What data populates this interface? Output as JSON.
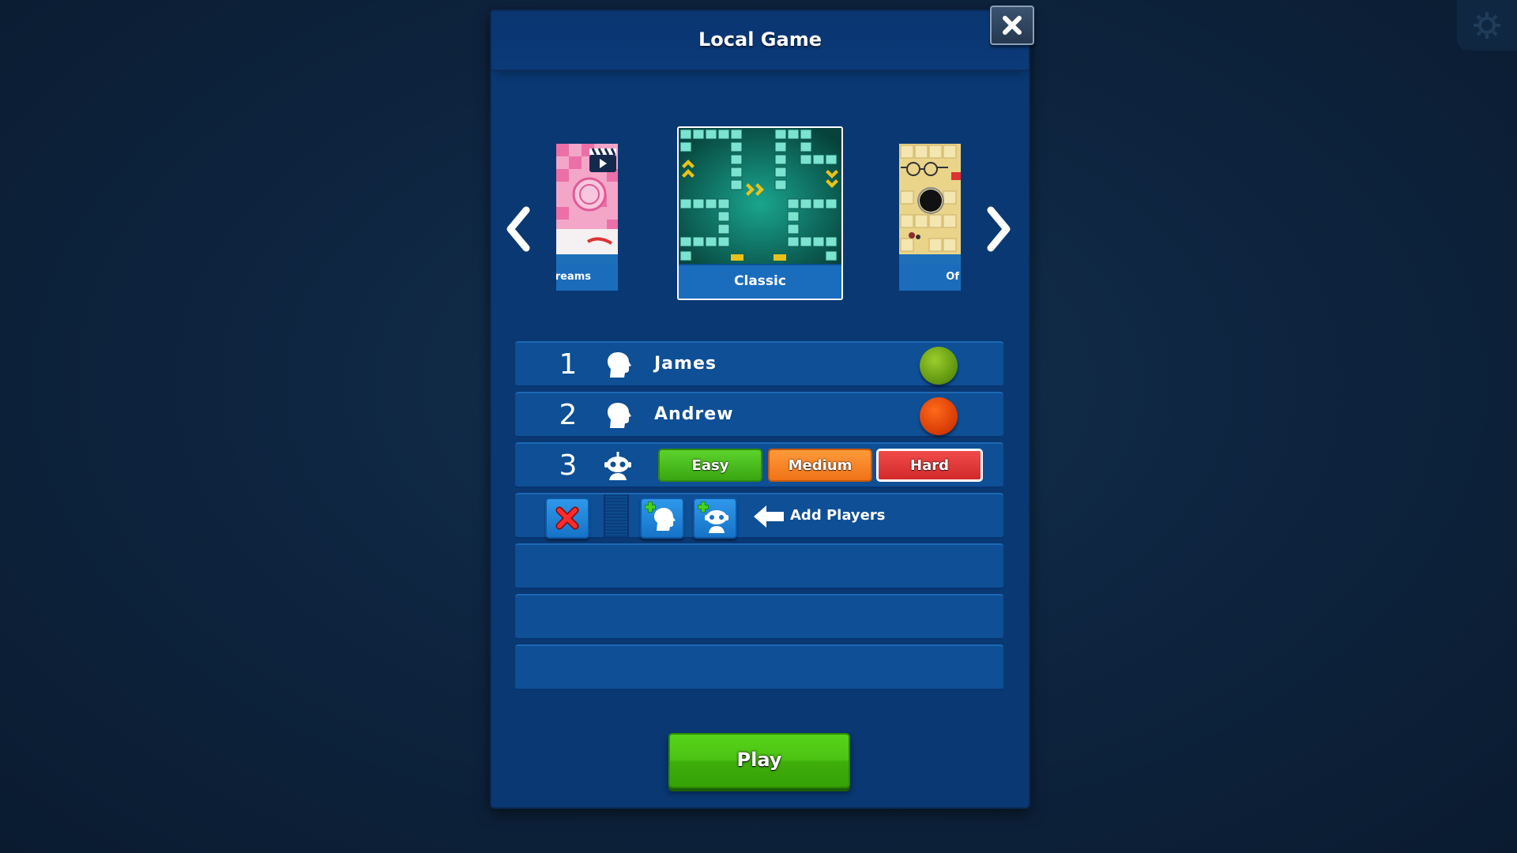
{
  "dialog": {
    "title": "Local Game",
    "close_icon": "close-x-icon"
  },
  "settings": {
    "icon": "gear-icon"
  },
  "board_carousel": {
    "prev_icon": "chevron-left-icon",
    "next_icon": "chevron-right-icon",
    "boards": [
      {
        "label": "reams",
        "visible_partial": true,
        "badge_icon": "video-clapper-icon"
      },
      {
        "label": "Classic",
        "selected": true
      },
      {
        "label": "Of",
        "visible_partial": true
      }
    ]
  },
  "players": [
    {
      "number": "1",
      "type": "human",
      "type_icon": "human-head-icon",
      "name": "James",
      "chip_color": "#6fae12"
    },
    {
      "number": "2",
      "type": "human",
      "type_icon": "human-head-icon",
      "name": "Andrew",
      "chip_color": "#e34a0a"
    },
    {
      "number": "3",
      "type": "computer",
      "type_icon": "robot-icon",
      "difficulty_options": [
        "Easy",
        "Medium",
        "Hard"
      ],
      "selected_difficulty": "Hard"
    }
  ],
  "add_row": {
    "remove_icon": "red-x-icon",
    "add_human_icon": "add-human-icon",
    "add_robot_icon": "add-robot-icon",
    "arrow_icon": "arrow-left-icon",
    "label": "Add Players"
  },
  "empty_slots": 3,
  "play_button": {
    "label": "Play"
  },
  "colors": {
    "panel": "#0a3873",
    "row": "#0e4f95",
    "play_green": "#4cc413",
    "easy": "#4cc41d",
    "medium": "#f7861f",
    "hard": "#e03838"
  }
}
